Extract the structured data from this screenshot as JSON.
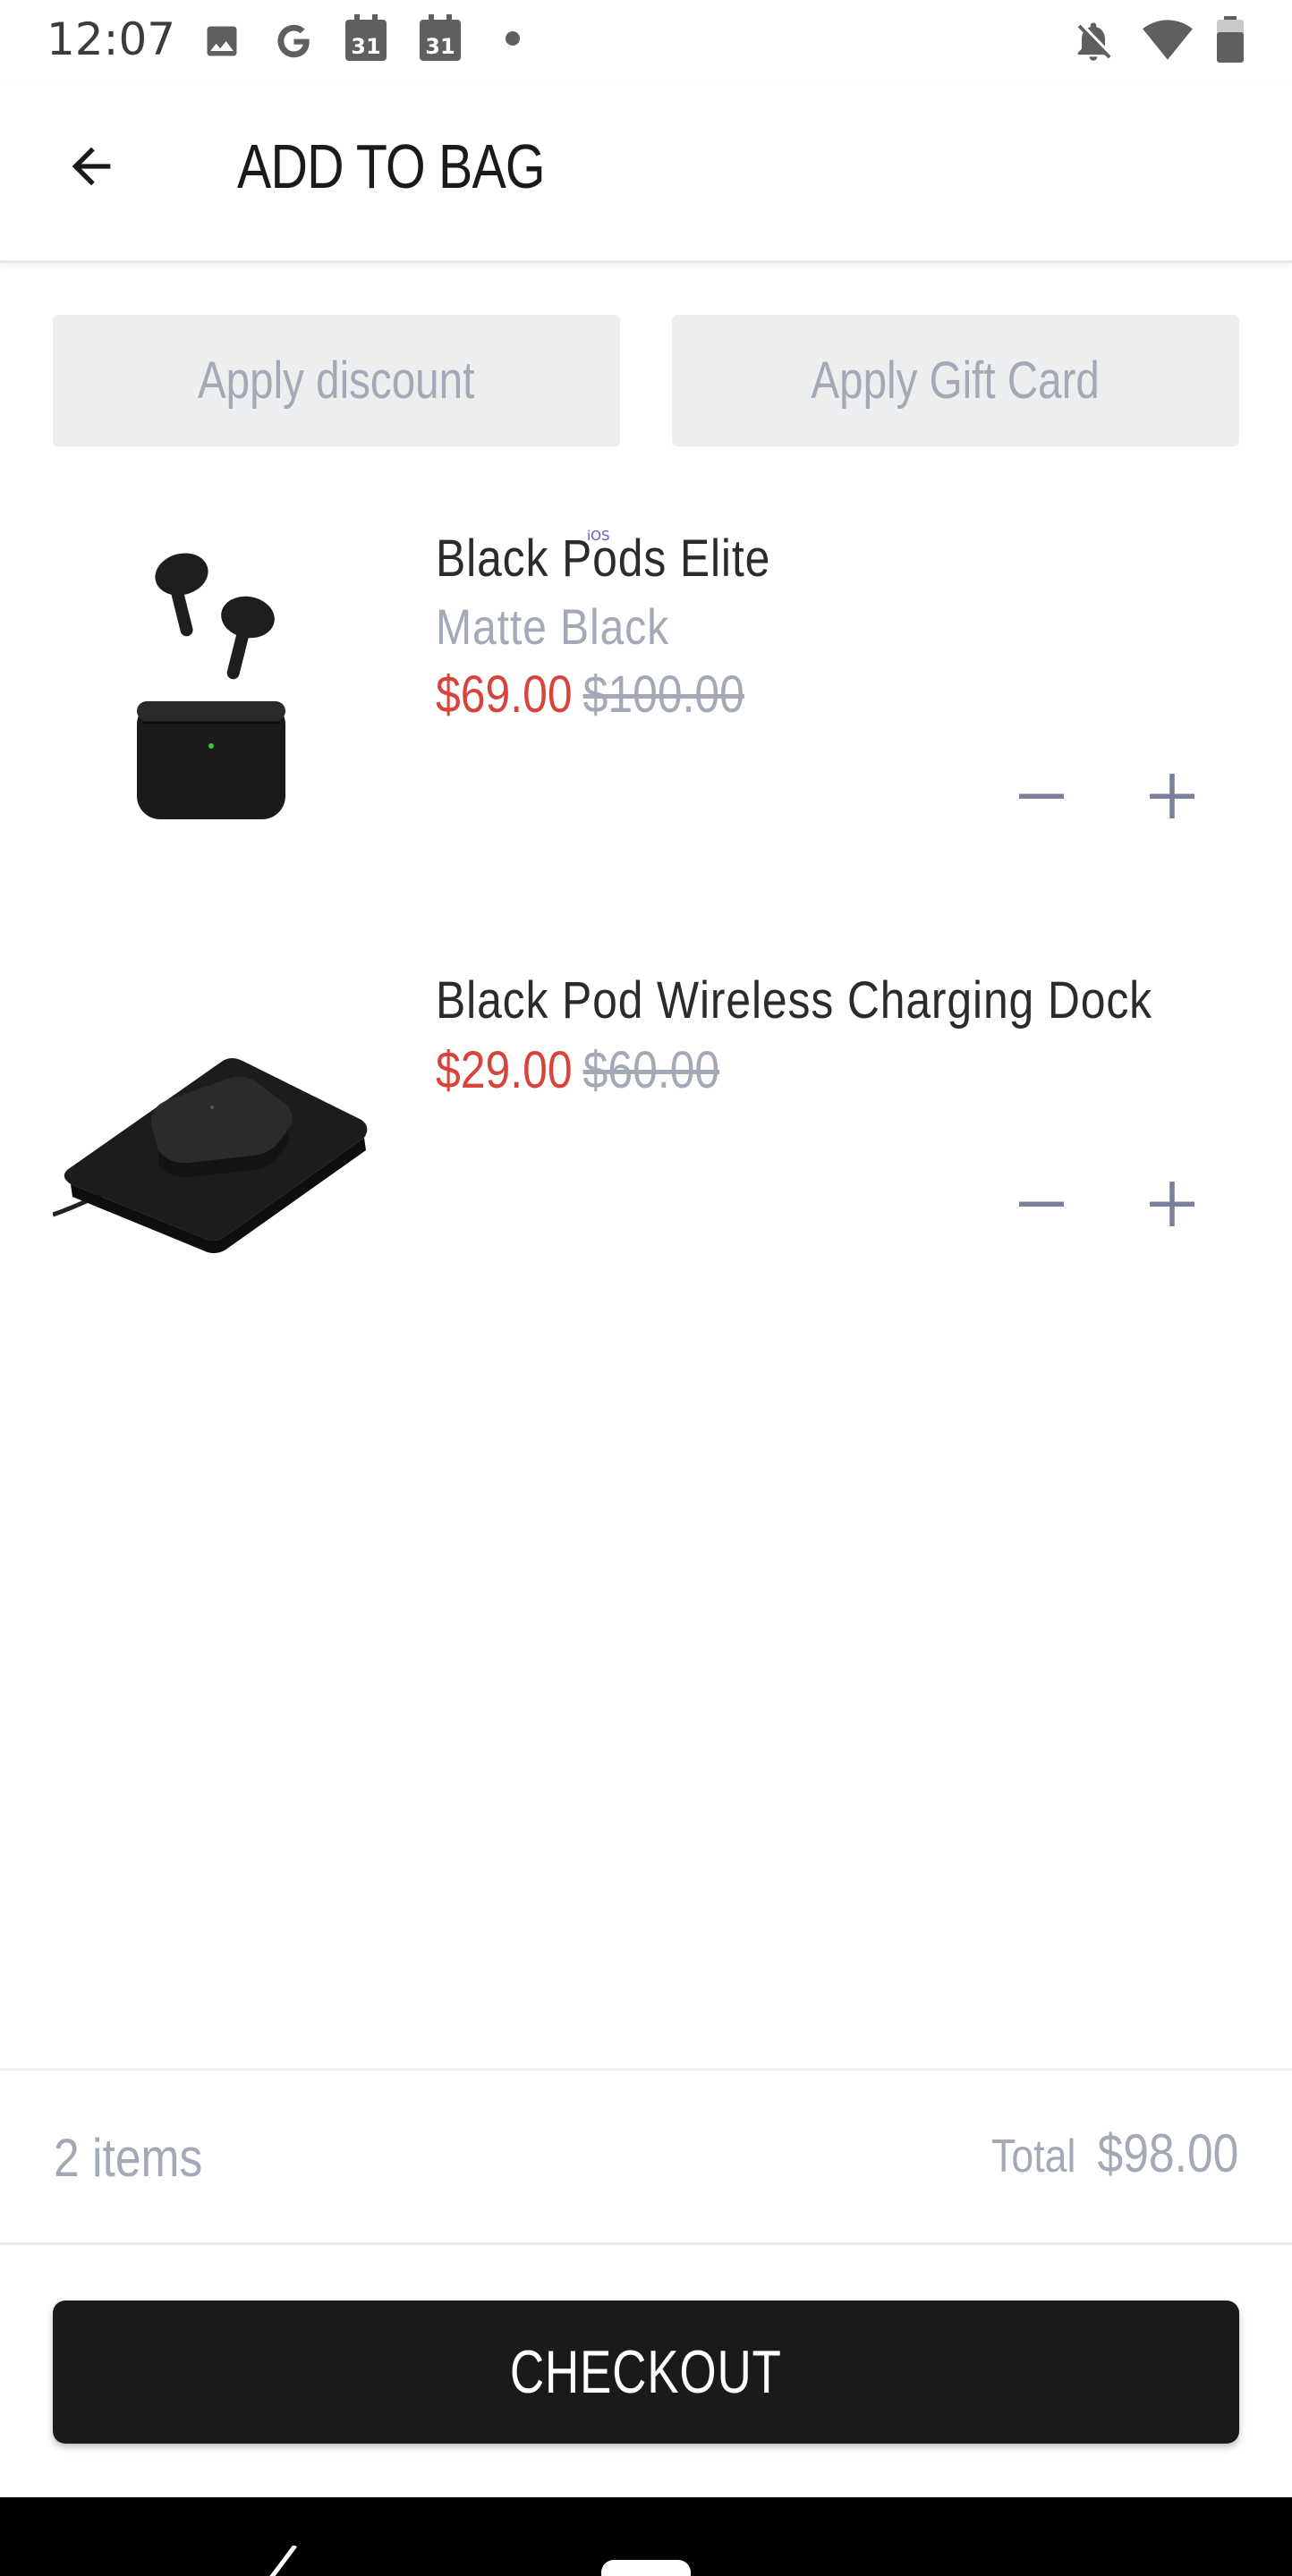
{
  "status_bar": {
    "time": "12:07",
    "left_icons": [
      "image-icon",
      "google-icon",
      "calendar-icon",
      "calendar-icon",
      "dot-icon"
    ],
    "right_icons": [
      "notifications-off-icon",
      "wifi-icon",
      "battery-icon"
    ],
    "calendar_day": "31"
  },
  "header": {
    "title": "ADD TO BAG",
    "back_icon": "arrow-left-icon"
  },
  "promo": {
    "discount_label": "Apply discount",
    "gift_card_label": "Apply Gift Card"
  },
  "items": [
    {
      "name": "Black Pods Elite",
      "variant": "Matte Black",
      "sale_price": "$69.00",
      "original_price": "$100.00",
      "image": "earbuds-image"
    },
    {
      "name": "Black Pod Wireless Charging Dock",
      "variant": "",
      "sale_price": "$29.00",
      "original_price": "$60.00",
      "image": "charging-dock-image"
    }
  ],
  "overlay_tag": "iOS",
  "summary": {
    "items_count": "2 items",
    "total_label": "Total",
    "total_value": "$98.00"
  },
  "checkout": {
    "label": "CHECKOUT"
  },
  "colors": {
    "sale_price": "#d8443c",
    "muted_text": "#a3a9b6",
    "button_bg": "#eceeef",
    "checkout_bg": "#1a1a1a",
    "qty_icon": "#7a7f99"
  }
}
